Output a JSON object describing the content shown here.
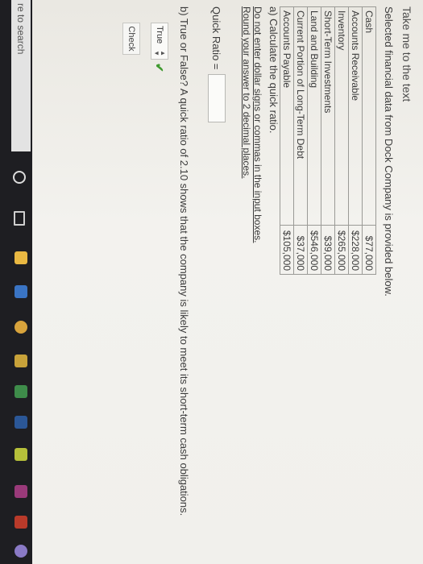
{
  "header": {
    "take_me_link": "Take me to the text",
    "intro": "Selected financial data from Dock Company is provided below."
  },
  "financial_table": [
    {
      "label": "Cash",
      "value": "$77,000"
    },
    {
      "label": "Accounts Receivable",
      "value": "$228,000"
    },
    {
      "label": "Inventory",
      "value": "$265,000"
    },
    {
      "label": "Short-Term Investments",
      "value": "$39,000"
    },
    {
      "label": "Land and Building",
      "value": "$546,000"
    },
    {
      "label": "Current Portion of Long-Term Debt",
      "value": "$37,000"
    },
    {
      "label": "Accounts Payable",
      "value": "$105,000"
    }
  ],
  "part_a": {
    "question": "a) Calculate the quick ratio.",
    "note_line1": "Do not enter dollar signs or commas in the input boxes.",
    "note_line2": "Round your answer to 2 decimal places.",
    "quick_ratio_label": "Quick Ratio =",
    "quick_ratio_value": ""
  },
  "part_b": {
    "question": "b) True or False? A quick ratio of 2.10 shows that the company is likely to meet its short-term cash obligations.",
    "selected": "True",
    "check_label": "Check"
  },
  "taskbar": {
    "search_text": "re to search"
  }
}
